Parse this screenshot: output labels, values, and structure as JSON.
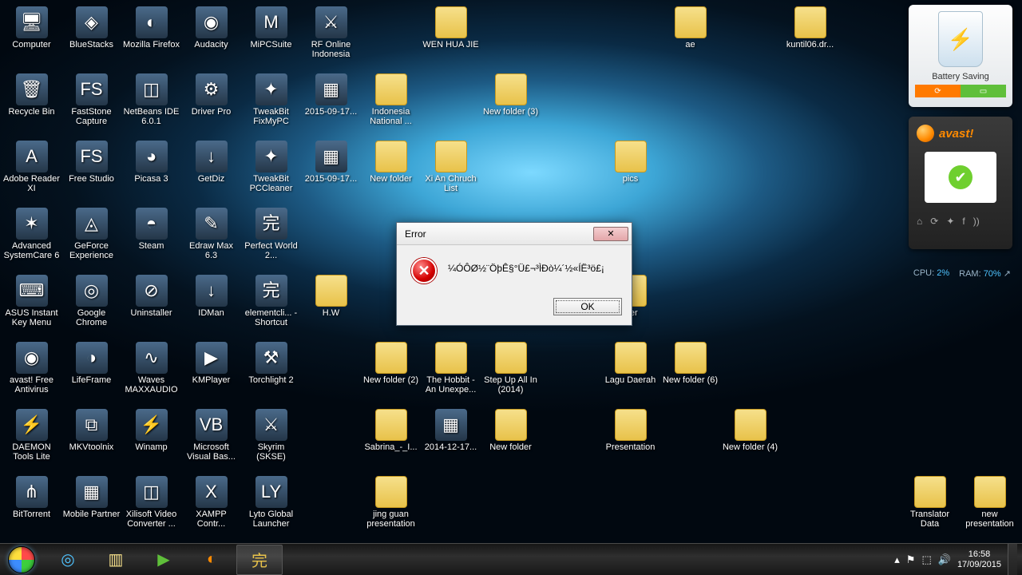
{
  "dialog": {
    "title": "Error",
    "message": "¼ÓÔØ½¨ÖþÊ§°Ü£¬³ÌÐò¼´½«ÍË³ö£¡",
    "ok": "OK",
    "close_glyph": "✕"
  },
  "gadgets": {
    "battery_label": "Battery Saving",
    "battery_left_glyph": "⟳",
    "battery_right_glyph": "▭",
    "avast_label": "avast!",
    "cpu_label": "CPU:",
    "cpu_value": "2%",
    "ram_label": "RAM:",
    "ram_value": "70%"
  },
  "taskbar": {
    "time": "16:58",
    "date": "17/09/2015",
    "items": [
      {
        "name": "chrome",
        "glyph": "◎",
        "color": "#4fc3ff"
      },
      {
        "name": "explorer",
        "glyph": "▥",
        "color": "#f6e08b"
      },
      {
        "name": "wmplayer",
        "glyph": "▶",
        "color": "#5fbf3a"
      },
      {
        "name": "firefox",
        "glyph": "◐",
        "color": "#ff8a00"
      },
      {
        "name": "perfectworld",
        "glyph": "完",
        "color": "#e8c24a",
        "active": true
      }
    ],
    "tray_glyphs": [
      "▴",
      "⚑",
      "⬚",
      "🔊"
    ]
  },
  "icons": [
    {
      "c": 1,
      "r": 1,
      "t": "app",
      "g": "🖥",
      "label": "Computer"
    },
    {
      "c": 2,
      "r": 1,
      "t": "app",
      "g": "◈",
      "label": "BlueStacks"
    },
    {
      "c": 3,
      "r": 1,
      "t": "app",
      "g": "◐",
      "label": "Mozilla Firefox"
    },
    {
      "c": 4,
      "r": 1,
      "t": "app",
      "g": "◉",
      "label": "Audacity"
    },
    {
      "c": 5,
      "r": 1,
      "t": "app",
      "g": "M",
      "label": "MiPCSuite"
    },
    {
      "c": 6,
      "r": 1,
      "t": "app",
      "g": "⚔",
      "label": "RF Online Indonesia"
    },
    {
      "c": 8,
      "r": 1,
      "t": "folder",
      "g": "",
      "label": "WEN HUA JIE"
    },
    {
      "c": 12,
      "r": 1,
      "t": "folder",
      "g": "",
      "label": "ae"
    },
    {
      "c": 14,
      "r": 1,
      "t": "folder",
      "g": "",
      "label": "kuntil06.dr..."
    },
    {
      "c": 1,
      "r": 2,
      "t": "app",
      "g": "🗑",
      "label": "Recycle Bin"
    },
    {
      "c": 2,
      "r": 2,
      "t": "app",
      "g": "FS",
      "label": "FastStone Capture"
    },
    {
      "c": 3,
      "r": 2,
      "t": "app",
      "g": "◫",
      "label": "NetBeans IDE 6.0.1"
    },
    {
      "c": 4,
      "r": 2,
      "t": "app",
      "g": "⚙",
      "label": "Driver Pro"
    },
    {
      "c": 5,
      "r": 2,
      "t": "app",
      "g": "✦",
      "label": "TweakBit FixMyPC"
    },
    {
      "c": 6,
      "r": 2,
      "t": "app",
      "g": "▦",
      "label": "2015-09-17..."
    },
    {
      "c": 7,
      "r": 2,
      "t": "folder",
      "g": "",
      "label": "Indonesia National ..."
    },
    {
      "c": 9,
      "r": 2,
      "t": "folder",
      "g": "",
      "label": "New folder (3)"
    },
    {
      "c": 1,
      "r": 3,
      "t": "app",
      "g": "A",
      "label": "Adobe Reader XI"
    },
    {
      "c": 2,
      "r": 3,
      "t": "app",
      "g": "FS",
      "label": "Free Studio"
    },
    {
      "c": 3,
      "r": 3,
      "t": "app",
      "g": "◕",
      "label": "Picasa 3"
    },
    {
      "c": 4,
      "r": 3,
      "t": "app",
      "g": "↓",
      "label": "GetDiz"
    },
    {
      "c": 5,
      "r": 3,
      "t": "app",
      "g": "✦",
      "label": "TweakBit PCCleaner"
    },
    {
      "c": 6,
      "r": 3,
      "t": "app",
      "g": "▦",
      "label": "2015-09-17..."
    },
    {
      "c": 7,
      "r": 3,
      "t": "folder",
      "g": "",
      "label": "New folder"
    },
    {
      "c": 8,
      "r": 3,
      "t": "folder",
      "g": "",
      "label": "Xi An Chruch List"
    },
    {
      "c": 11,
      "r": 3,
      "t": "folder",
      "g": "",
      "label": "pics"
    },
    {
      "c": 1,
      "r": 4,
      "t": "app",
      "g": "✶",
      "label": "Advanced SystemCare 6"
    },
    {
      "c": 2,
      "r": 4,
      "t": "app",
      "g": "◬",
      "label": "GeForce Experience"
    },
    {
      "c": 3,
      "r": 4,
      "t": "app",
      "g": "◓",
      "label": "Steam"
    },
    {
      "c": 4,
      "r": 4,
      "t": "app",
      "g": "✎",
      "label": "Edraw Max 6.3"
    },
    {
      "c": 5,
      "r": 4,
      "t": "app",
      "g": "完",
      "label": "Perfect World 2..."
    },
    {
      "c": 1,
      "r": 5,
      "t": "app",
      "g": "⌨",
      "label": "ASUS Instant Key Menu"
    },
    {
      "c": 2,
      "r": 5,
      "t": "app",
      "g": "◎",
      "label": "Google Chrome"
    },
    {
      "c": 3,
      "r": 5,
      "t": "app",
      "g": "⊘",
      "label": "Uninstaller"
    },
    {
      "c": 4,
      "r": 5,
      "t": "app",
      "g": "↓",
      "label": "IDMan"
    },
    {
      "c": 5,
      "r": 5,
      "t": "app",
      "g": "完",
      "label": "elementcli... - Shortcut"
    },
    {
      "c": 6,
      "r": 5,
      "t": "folder",
      "g": "",
      "label": "H.W"
    },
    {
      "c": 11,
      "r": 5,
      "t": "folder",
      "g": "",
      "label": "lder"
    },
    {
      "c": 1,
      "r": 6,
      "t": "app",
      "g": "◉",
      "label": "avast! Free Antivirus"
    },
    {
      "c": 2,
      "r": 6,
      "t": "app",
      "g": "◑",
      "label": "LifeFrame"
    },
    {
      "c": 3,
      "r": 6,
      "t": "app",
      "g": "∿",
      "label": "Waves MAXXAUDIO"
    },
    {
      "c": 4,
      "r": 6,
      "t": "app",
      "g": "▶",
      "label": "KMPlayer"
    },
    {
      "c": 5,
      "r": 6,
      "t": "app",
      "g": "⚒",
      "label": "Torchlight 2"
    },
    {
      "c": 7,
      "r": 6,
      "t": "folder",
      "g": "",
      "label": "New folder (2)"
    },
    {
      "c": 8,
      "r": 6,
      "t": "folder",
      "g": "",
      "label": "The Hobbit - An Unexpe..."
    },
    {
      "c": 9,
      "r": 6,
      "t": "folder",
      "g": "",
      "label": "Step Up All In (2014)"
    },
    {
      "c": 11,
      "r": 6,
      "t": "folder",
      "g": "",
      "label": "Lagu Daerah"
    },
    {
      "c": 12,
      "r": 6,
      "t": "folder",
      "g": "",
      "label": "New folder (6)"
    },
    {
      "c": 1,
      "r": 7,
      "t": "app",
      "g": "⚡",
      "label": "DAEMON Tools Lite"
    },
    {
      "c": 2,
      "r": 7,
      "t": "app",
      "g": "⧉",
      "label": "MKVtoolnix"
    },
    {
      "c": 3,
      "r": 7,
      "t": "app",
      "g": "⚡",
      "label": "Winamp"
    },
    {
      "c": 4,
      "r": 7,
      "t": "app",
      "g": "VB",
      "label": "Microsoft Visual Bas..."
    },
    {
      "c": 5,
      "r": 7,
      "t": "app",
      "g": "⚔",
      "label": "Skyrim (SKSE)"
    },
    {
      "c": 7,
      "r": 7,
      "t": "folder",
      "g": "",
      "label": "Sabrina_-_I..."
    },
    {
      "c": 8,
      "r": 7,
      "t": "app",
      "g": "▦",
      "label": "2014-12-17..."
    },
    {
      "c": 9,
      "r": 7,
      "t": "folder",
      "g": "",
      "label": "New folder"
    },
    {
      "c": 11,
      "r": 7,
      "t": "folder",
      "g": "",
      "label": "Presentation"
    },
    {
      "c": 13,
      "r": 7,
      "t": "folder",
      "g": "",
      "label": "New folder (4)"
    },
    {
      "c": 1,
      "r": 8,
      "t": "app",
      "g": "⋔",
      "label": "BitTorrent"
    },
    {
      "c": 2,
      "r": 8,
      "t": "app",
      "g": "▦",
      "label": "Mobile Partner"
    },
    {
      "c": 3,
      "r": 8,
      "t": "app",
      "g": "◫",
      "label": "Xilisoft Video Converter ..."
    },
    {
      "c": 4,
      "r": 8,
      "t": "app",
      "g": "X",
      "label": "XAMPP Contr..."
    },
    {
      "c": 5,
      "r": 8,
      "t": "app",
      "g": "LY",
      "label": "Lyto Global Launcher"
    },
    {
      "c": 7,
      "r": 8,
      "t": "folder",
      "g": "",
      "label": "jing guan presentation"
    },
    {
      "c": 16,
      "r": 8,
      "t": "folder",
      "g": "",
      "label": "Translator Data"
    },
    {
      "c": 17,
      "r": 8,
      "t": "folder",
      "g": "",
      "label": "new presentation"
    }
  ]
}
